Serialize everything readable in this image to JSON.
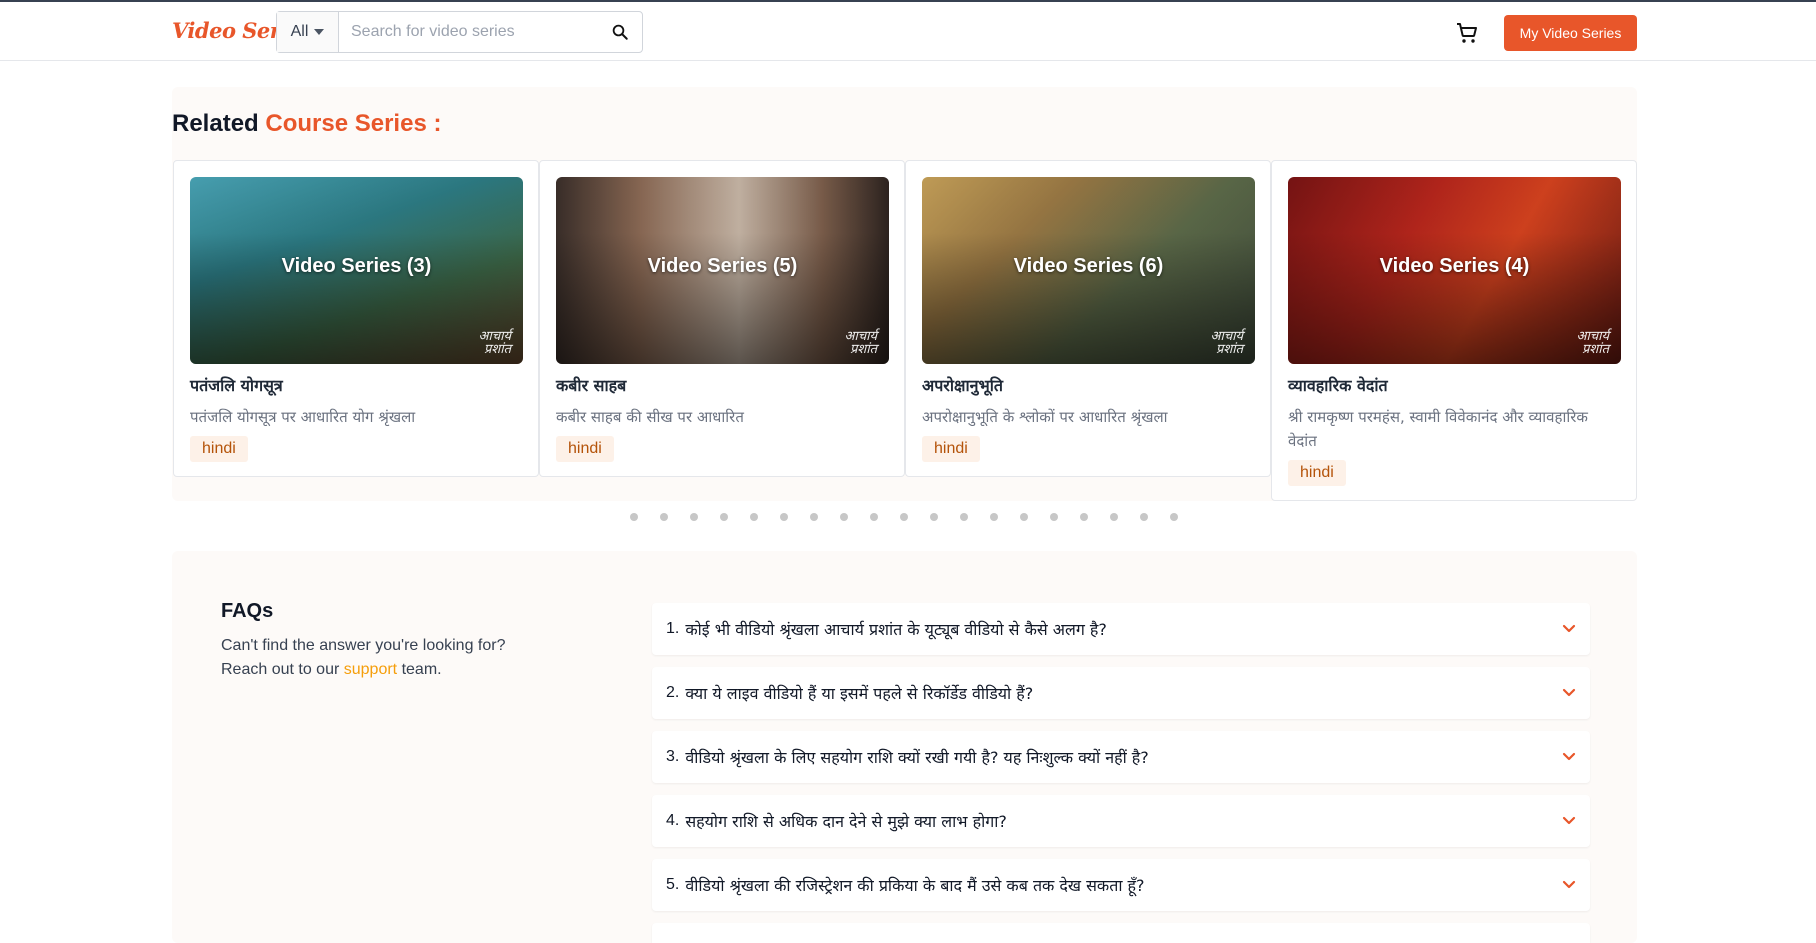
{
  "header": {
    "logo": "Video Series",
    "category": "All",
    "search_placeholder": "Search for video series",
    "my_series_label": "My Video Series"
  },
  "related": {
    "title_prefix": "Related ",
    "title_accent": "Course Series :",
    "cards": [
      {
        "overlay": "Video Series (3)",
        "watermark_top": "आचार्य",
        "watermark_bottom": "प्रशांत",
        "title": "पतंजलि योगसूत्र",
        "desc": "पतंजलि योगसूत्र पर आधारित योग श्रृंखला",
        "tag": "hindi"
      },
      {
        "overlay": "Video Series (5)",
        "watermark_top": "आचार्य",
        "watermark_bottom": "प्रशांत",
        "title": "कबीर साहब",
        "desc": "कबीर साहब की सीख पर आधारित",
        "tag": "hindi"
      },
      {
        "overlay": "Video Series (6)",
        "watermark_top": "आचार्य",
        "watermark_bottom": "प्रशांत",
        "title": "अपरोक्षानुभूति",
        "desc": "अपरोक्षानुभूति के श्लोकों पर आधारित श्रृंखला",
        "tag": "hindi"
      },
      {
        "overlay": "Video Series (4)",
        "watermark_top": "आचार्य",
        "watermark_bottom": "प्रशांत",
        "title": "व्यावहारिक वेदांत",
        "desc": "श्री रामकृष्ण परमहंस, स्वामी विवेकानंद और व्यावहारिक वेदांत",
        "tag": "hindi"
      }
    ],
    "dot_count": 19
  },
  "faq": {
    "heading": "FAQs",
    "sub_line1": "Can't find the answer you're looking for?",
    "sub_prefix": "Reach out to our ",
    "sub_link": "support",
    "sub_suffix": " team.",
    "items": [
      {
        "num": "1.",
        "q": "कोई भी वीडियो श्रृंखला आचार्य प्रशांत के यूट्यूब वीडियो से कैसे अलग है?"
      },
      {
        "num": "2.",
        "q": "क्या ये लाइव वीडियो हैं या इसमें पहले से रिकॉर्डेड वीडियो हैं?"
      },
      {
        "num": "3.",
        "q": "वीडियो श्रृंखला के लिए सहयोग राशि क्यों रखी गयी है? यह निःशुल्क क्यों नहीं है?"
      },
      {
        "num": "4.",
        "q": "सहयोग राशि से अधिक दान देने से मुझे क्या लाभ होगा?"
      },
      {
        "num": "5.",
        "q": "वीडियो श्रृंखला की रजिस्ट्रेशन की प्रकिया के बाद मैं उसे कब तक देख सकता हूँ?"
      }
    ]
  },
  "colors": {
    "accent": "#e8562a",
    "link": "#f59e0b",
    "tag_bg": "#fdf1e8"
  }
}
